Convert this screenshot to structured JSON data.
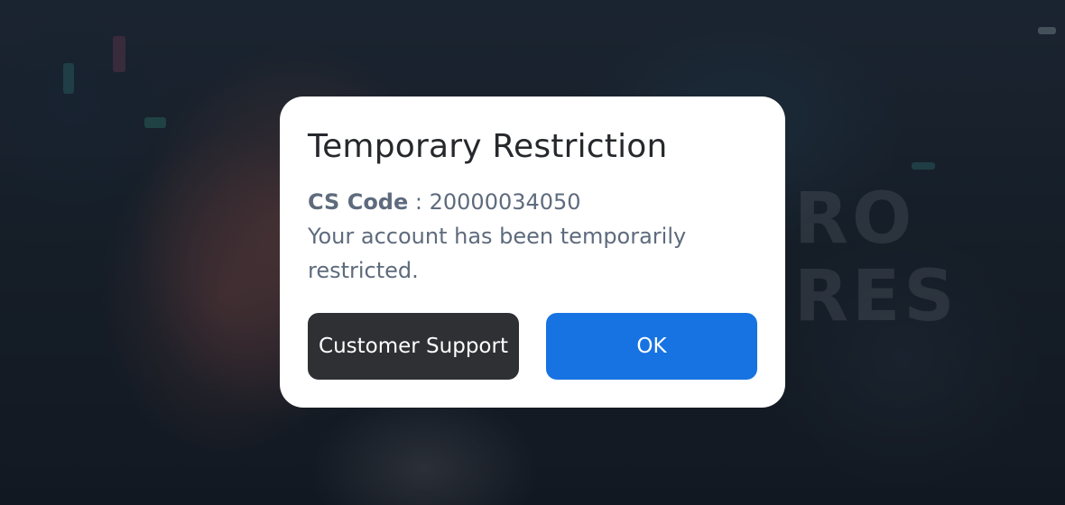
{
  "dialog": {
    "title": "Temporary Restriction",
    "cs_code_label": "CS Code",
    "cs_code_separator": " : ",
    "cs_code_value": "20000034050",
    "message": "Your account has been temporarily restricted."
  },
  "buttons": {
    "support_label": "Customer Support",
    "ok_label": "OK"
  },
  "background": {
    "logo_line1": "RO",
    "logo_line2": "RES"
  },
  "colors": {
    "ok_button": "#1773e2",
    "support_button": "#2e3034",
    "dialog_background": "#ffffff",
    "overlay": "rgba(15,20,28,0.45)"
  }
}
